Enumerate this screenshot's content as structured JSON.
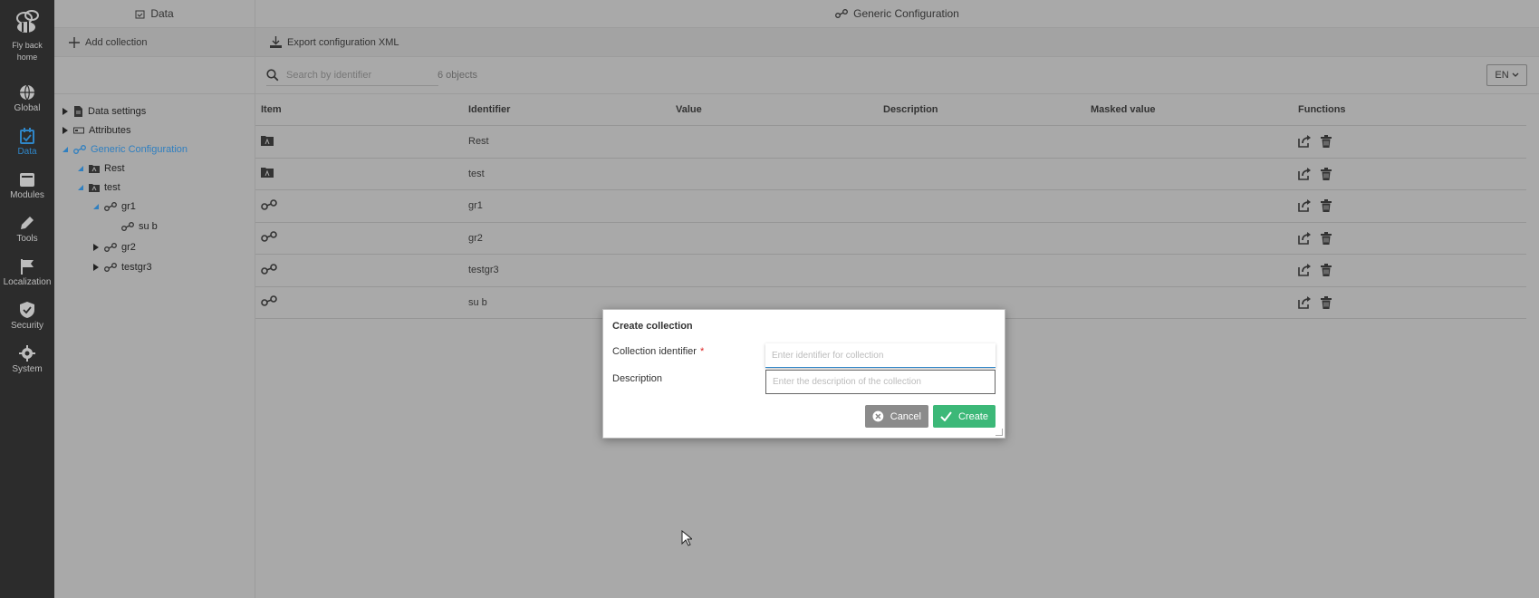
{
  "nav": {
    "logo_label_line1": "Fly back",
    "logo_label_line2": "home",
    "items": [
      {
        "label": "Global",
        "icon": "globe-icon"
      },
      {
        "label": "Data",
        "icon": "data-icon",
        "active": true
      },
      {
        "label": "Modules",
        "icon": "modules-icon"
      },
      {
        "label": "Tools",
        "icon": "pencil-icon"
      },
      {
        "label": "Localization",
        "icon": "flag-icon"
      },
      {
        "label": "Security",
        "icon": "shield-icon"
      },
      {
        "label": "System",
        "icon": "gear-icon"
      }
    ],
    "active_color": "#2f86c8"
  },
  "tree_panel": {
    "header": "Data",
    "add_collection_label": "Add collection",
    "nodes": [
      {
        "label": "Data settings",
        "expanded": false
      },
      {
        "label": "Attributes",
        "expanded": false
      },
      {
        "label": "Generic Configuration",
        "expanded": true,
        "selected": true
      },
      {
        "label": "Rest",
        "expanded": true
      },
      {
        "label": "test",
        "expanded": true
      },
      {
        "label": "gr1",
        "expanded": true
      },
      {
        "label": "su b"
      },
      {
        "label": "gr2",
        "expanded": false
      },
      {
        "label": "testgr3",
        "expanded": false
      }
    ]
  },
  "main": {
    "header": "Generic Configuration",
    "export_label": "Export configuration XML",
    "search_placeholder": "Search by identifier",
    "object_count": "6 objects",
    "language": "EN",
    "columns": [
      "Item",
      "Identifier",
      "Value",
      "Description",
      "Masked value",
      "Functions"
    ],
    "rows": [
      {
        "item_icon": "folder-icon",
        "identifier": "Rest",
        "value": "",
        "description": "",
        "masked_value": ""
      },
      {
        "item_icon": "folder-icon",
        "identifier": "test",
        "value": "",
        "description": "",
        "masked_value": ""
      },
      {
        "item_icon": "group-link-icon",
        "identifier": "gr1",
        "value": "",
        "description": "",
        "masked_value": ""
      },
      {
        "item_icon": "group-link-icon",
        "identifier": "gr2",
        "value": "",
        "description": "",
        "masked_value": ""
      },
      {
        "item_icon": "group-link-icon",
        "identifier": "testgr3",
        "value": "",
        "description": "",
        "masked_value": ""
      },
      {
        "item_icon": "group-link-icon",
        "identifier": "su b",
        "value": "",
        "description": "",
        "masked_value": ""
      }
    ]
  },
  "modal": {
    "title": "Create collection",
    "identifier_label": "Collection identifier",
    "required_marker": "*",
    "identifier_placeholder": "Enter identifier for collection",
    "description_label": "Description",
    "description_placeholder": "Enter the description of the collection",
    "cancel_label": "Cancel",
    "create_label": "Create",
    "create_color": "#3cb878",
    "cancel_color": "#8b8b8b"
  }
}
